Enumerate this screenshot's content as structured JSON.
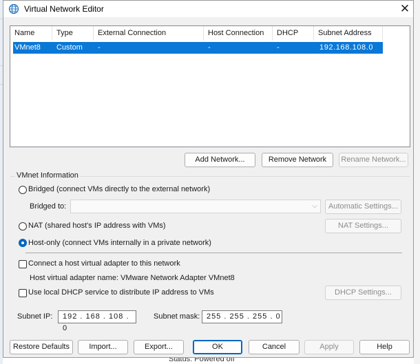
{
  "dialog": {
    "title": "Virtual Network Editor",
    "close_glyph": "✕"
  },
  "table": {
    "columns": [
      "Name",
      "Type",
      "External Connection",
      "Host Connection",
      "DHCP",
      "Subnet Address"
    ],
    "rows": [
      {
        "name": "VMnet8",
        "type": "Custom",
        "external": "-",
        "host": "-",
        "dhcp": "-",
        "subnet": "192.168.108.0"
      }
    ]
  },
  "table_buttons": {
    "add": "Add Network...",
    "remove": "Remove Network",
    "rename": "Rename Network..."
  },
  "vmnet_info": {
    "group_label": "VMnet Information",
    "bridged_label": "Bridged (connect VMs directly to the external network)",
    "bridged_to_label": "Bridged to:",
    "bridged_to_value": "",
    "automatic_settings": "Automatic Settings...",
    "nat_label": "NAT (shared host's IP address with VMs)",
    "nat_settings": "NAT Settings...",
    "hostonly_label": "Host-only (connect VMs internally in a private network)",
    "selected_mode": "host-only",
    "connect_adapter_label": "Connect a host virtual adapter to this network",
    "connect_adapter_checked": false,
    "adapter_name_label": "Host virtual adapter name: VMware Network Adapter VMnet8",
    "dhcp_label": "Use local DHCP service to distribute IP address to VMs",
    "dhcp_checked": false,
    "dhcp_settings": "DHCP Settings...",
    "subnet_ip_label": "Subnet IP:",
    "subnet_ip_value": "192 . 168 . 108 .  0",
    "subnet_mask_label": "Subnet mask:",
    "subnet_mask_value": "255 . 255 . 255 .  0"
  },
  "footer_buttons": {
    "restore": "Restore Defaults",
    "import": "Import...",
    "export": "Export...",
    "ok": "OK",
    "cancel": "Cancel",
    "apply": "Apply",
    "help": "Help"
  },
  "background": {
    "bottom_text": "Status: Powered off"
  },
  "colors": {
    "selection": "#0a78d7",
    "accent": "#0067c0"
  },
  "icons": {
    "title": "globe-network-icon",
    "dropdown": "chevron-down-icon"
  }
}
